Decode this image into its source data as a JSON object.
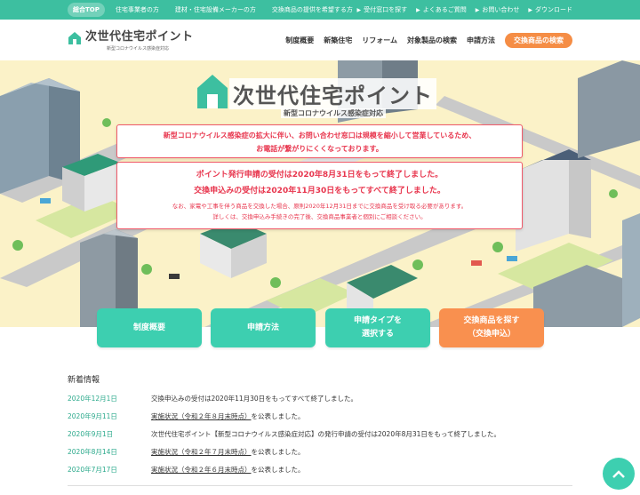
{
  "topbar": {
    "left_links": [
      "総合TOP",
      "住宅事業者の方",
      "建材・住宅設備メーカーの方",
      "交換商品の提供を希望する方"
    ],
    "right_links": [
      "受付窓口を探す",
      "よくあるご質問",
      "お問い合わせ",
      "ダウンロード"
    ]
  },
  "header": {
    "logo_name": "次世代住宅ポイント",
    "logo_sub": "新型コロナウイルス感染症対応",
    "nav": [
      "制度概要",
      "新築住宅",
      "リフォーム",
      "対象製品の検索",
      "申請方法"
    ],
    "cta_label": "交換商品の検索"
  },
  "hero": {
    "title": "次世代住宅ポイント",
    "subtitle": "新型コロナウイルス感染症対応",
    "notice1": [
      "新型コロナウイルス感染症の拡大に伴い、お問い合わせ窓口は規模を縮小して営業しているため、",
      "お電話が繋がりにくくなっております。"
    ],
    "notice2_big": [
      "ポイント発行申請の受付は2020年8月31日をもって終了しました。",
      "交換申込みの受付は2020年11月30日をもってすべて終了しました。"
    ],
    "notice2_small": [
      "なお、家電や工事を伴う商品を交換した場合、原則2020年12月31日までに交換商品を受け取る必要があります。",
      "詳しくは、交換申込み手続きの完了後、交換商品事業者と個別にご相談ください。"
    ]
  },
  "buttons": [
    {
      "line1": "制度概要",
      "line2": ""
    },
    {
      "line1": "申請方法",
      "line2": ""
    },
    {
      "line1": "申請タイプを",
      "line2": "選択する"
    },
    {
      "line1": "交換商品を探す",
      "line2": "（交換申込）"
    }
  ],
  "news": {
    "heading": "新着情報",
    "items": [
      {
        "date": "2020年12月1日",
        "text": "交換申込みの受付は2020年11月30日をもってすべて終了しました。",
        "link": false
      },
      {
        "date": "2020年9月11日",
        "link_text": "実施状況（令和２年８月末時点）",
        "text": "を公表しました。",
        "link": true
      },
      {
        "date": "2020年9月1日",
        "text": "次世代住宅ポイント【新型コロナウイルス感染症対応】の発行申請の受付は2020年8月31日をもって終了しました。",
        "link": false
      },
      {
        "date": "2020年8月14日",
        "link_text": "実施状況（令和２年７月末時点）",
        "text": "を公表しました。",
        "link": true
      },
      {
        "date": "2020年7月17日",
        "link_text": "実施状況（令和２年６月末時点）",
        "text": "を公表しました。",
        "link": true
      }
    ]
  },
  "colors": {
    "brand_green": "#3dbfa0",
    "button_green": "#3dcfb0",
    "orange": "#f58d45",
    "alert_red": "#e8364e"
  },
  "icons": {
    "scroll_top": "chevron-up-icon",
    "link_arrow": "chevron-right-icon",
    "logo": "house-icon"
  }
}
